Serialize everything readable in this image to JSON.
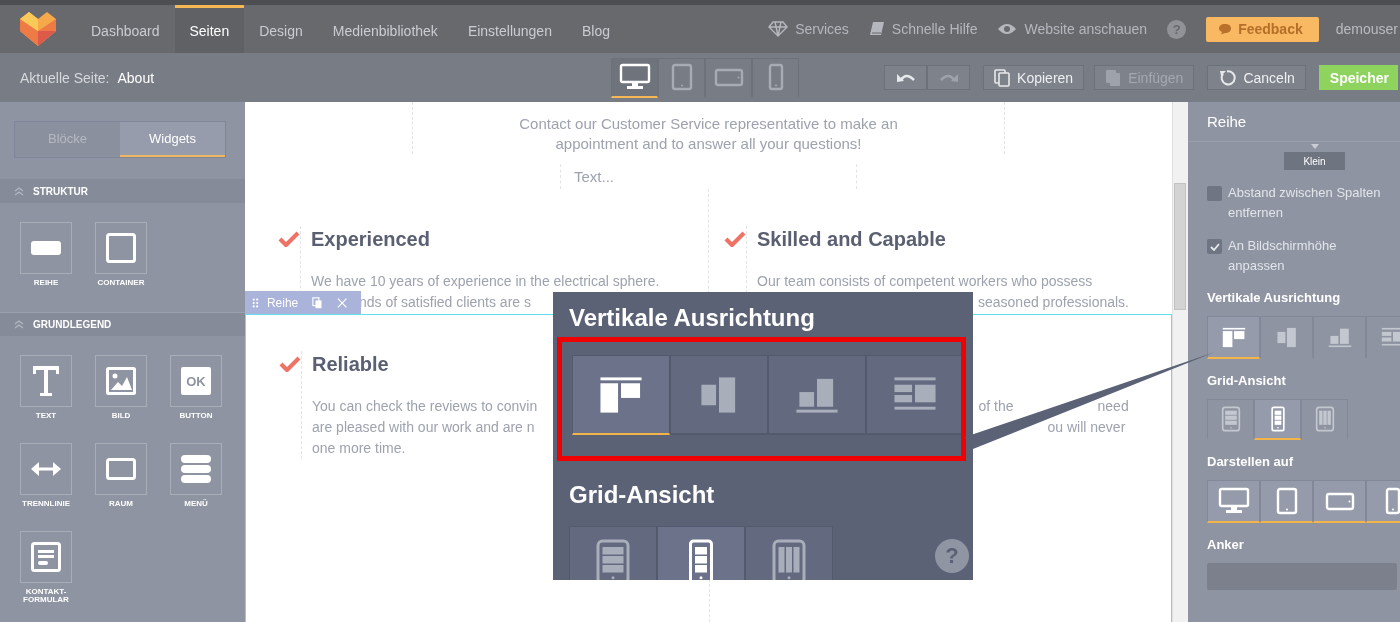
{
  "nav": {
    "tabs": [
      {
        "label": "Dashboard",
        "selected": false
      },
      {
        "label": "Seiten",
        "selected": true
      },
      {
        "label": "Design",
        "selected": false
      },
      {
        "label": "Medienbibliothek",
        "selected": false
      },
      {
        "label": "Einstellungen",
        "selected": false
      },
      {
        "label": "Blog",
        "selected": false
      }
    ],
    "links": [
      {
        "kind": "services",
        "label": "Services"
      },
      {
        "kind": "help",
        "label": "Schnelle Hilfe"
      },
      {
        "kind": "view",
        "label": "Website anschauen"
      }
    ],
    "help": "?",
    "feedback": "Feedback",
    "user": "demouser"
  },
  "toolbar": {
    "page_label": "Aktuelle Seite:",
    "page": "About",
    "devices": [
      {
        "kind": "desktop",
        "selected": true
      },
      {
        "kind": "tablet",
        "selected": false
      },
      {
        "kind": "tablet-landscape",
        "selected": false
      },
      {
        "kind": "phone",
        "selected": false
      }
    ],
    "history": [
      {
        "kind": "undo",
        "disabled": false
      },
      {
        "kind": "redo",
        "disabled": true
      }
    ],
    "buttons": [
      {
        "kind": "copy",
        "label": "Kopieren",
        "disabled": false
      },
      {
        "kind": "paste",
        "label": "Einfügen",
        "disabled": true
      },
      {
        "kind": "cancel",
        "label": "Canceln",
        "disabled": false
      },
      {
        "kind": "save",
        "label": "Speicher"
      }
    ]
  },
  "left_panel": {
    "tabs": [
      {
        "label": "Blöcke",
        "selected": false
      },
      {
        "label": "Widgets",
        "selected": true
      }
    ],
    "sections": [
      {
        "title": "STRUKTUR",
        "widgets": [
          {
            "kind": "row",
            "label": "REIHE"
          },
          {
            "kind": "container",
            "label": "CONTAINER"
          }
        ]
      },
      {
        "title": "GRUNDLEGEND",
        "widgets": [
          {
            "kind": "text",
            "label": "TEXT"
          },
          {
            "kind": "image",
            "label": "BILD"
          },
          {
            "kind": "button",
            "label": "BUTTON",
            "icon_text": "OK"
          },
          {
            "kind": "divider",
            "label": "TRENNLINIE"
          },
          {
            "kind": "space",
            "label": "RAUM"
          },
          {
            "kind": "menu",
            "label": "MENÜ"
          },
          {
            "kind": "form",
            "label": "KONTAKT-FORMULAR"
          }
        ]
      }
    ]
  },
  "canvas": {
    "intro": "Contact our Customer Service representative to make an appointment and to answer all your questions!",
    "placeholder": "Text...",
    "rows": [
      {
        "selected": false,
        "features": [
          {
            "heading": "Experienced",
            "lines": [
              [
                "We have 10 years of experience in the electrical sphere."
              ],
              [
                "nds of satisfied clients are s"
              ]
            ]
          },
          {
            "heading": "Skilled and Capable",
            "lines": [
              [
                "Our team consists of competent workers who possess"
              ],
              [
                "seasoned professionals."
              ]
            ]
          }
        ]
      },
      {
        "selected": true,
        "toolbar_label": "Reihe",
        "features": [
          {
            "heading": "Reliable",
            "lines": [
              [
                "You can check the reviews to convin"
              ],
              [
                "are pleased with our work and are n"
              ],
              [
                "one more time."
              ]
            ]
          },
          {
            "lines": [
              [
                "of the",
                "need"
              ],
              [
                "ou will never"
              ]
            ]
          }
        ]
      }
    ]
  },
  "right_panel": {
    "title": "Reihe",
    "size_button": "Klein",
    "options": [
      {
        "label": "Abstand zwischen Spalten entfernen",
        "checked": false
      },
      {
        "label": "An Bildschirmhöhe anpassen",
        "checked": true
      }
    ],
    "align_title": "Vertikale Ausrichtung",
    "align_options": [
      {
        "kind": "top",
        "selected": true
      },
      {
        "kind": "center",
        "selected": false
      },
      {
        "kind": "bottom",
        "selected": false
      },
      {
        "kind": "stretch",
        "selected": false
      }
    ],
    "grid_title": "Grid-Ansicht",
    "grid_options": [
      {
        "kind": "rows",
        "selected": false
      },
      {
        "kind": "stack",
        "selected": true
      },
      {
        "kind": "columns",
        "selected": false
      }
    ],
    "display_title": "Darstellen auf",
    "display_options": [
      {
        "kind": "desktop",
        "selected": true
      },
      {
        "kind": "tablet",
        "selected": true
      },
      {
        "kind": "tablet-landscape",
        "selected": true
      },
      {
        "kind": "phone",
        "selected": true
      }
    ],
    "anchor_title": "Anker"
  },
  "callout": {
    "title": "Vertikale Ausrichtung",
    "align_options": [
      {
        "kind": "top",
        "selected": true
      },
      {
        "kind": "center",
        "selected": false
      },
      {
        "kind": "bottom",
        "selected": false
      },
      {
        "kind": "stretch",
        "selected": false
      }
    ],
    "grid_title": "Grid-Ansicht",
    "grid_options": [
      {
        "kind": "rows",
        "selected": false
      },
      {
        "kind": "stack",
        "selected": true
      },
      {
        "kind": "columns",
        "selected": false
      }
    ],
    "help": "?"
  }
}
